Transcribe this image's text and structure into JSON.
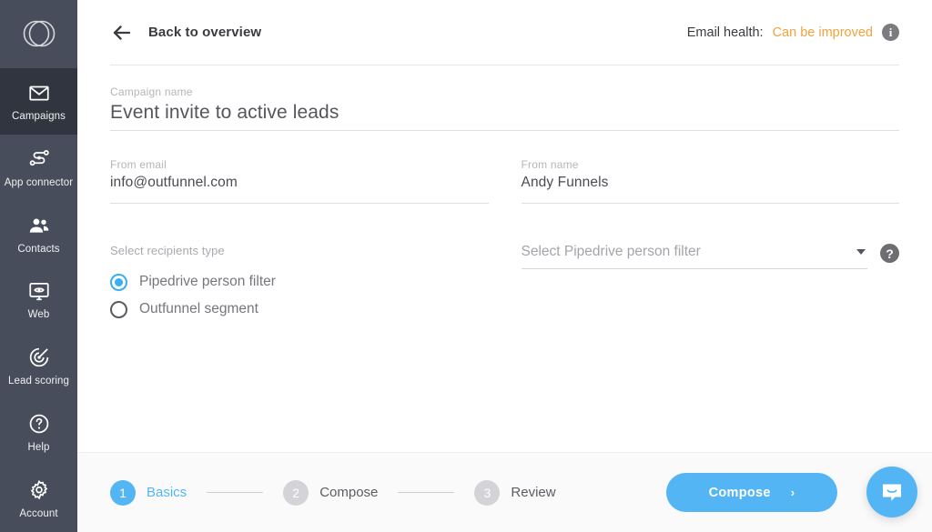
{
  "sidebar": {
    "logo_name": "outfunnel-logo",
    "items": [
      {
        "id": "campaigns",
        "label": "Campaigns",
        "icon": "envelope-icon",
        "active": true
      },
      {
        "id": "app-connector",
        "label": "App connector",
        "icon": "connector-icon",
        "active": false
      },
      {
        "id": "contacts",
        "label": "Contacts",
        "icon": "people-icon",
        "active": false
      },
      {
        "id": "web",
        "label": "Web",
        "icon": "monitor-eye-icon",
        "active": false
      },
      {
        "id": "lead-scoring",
        "label": "Lead scoring",
        "icon": "target-icon",
        "active": false
      },
      {
        "id": "help",
        "label": "Help",
        "icon": "question-circle-icon",
        "active": false
      },
      {
        "id": "account",
        "label": "Account",
        "icon": "gear-icon",
        "active": false
      }
    ]
  },
  "header": {
    "back_label": "Back to overview",
    "back_icon": "arrow-left-icon",
    "health_label": "Email health:",
    "health_value": "Can be improved",
    "health_info_icon": "i",
    "health_color": "#f3a23c"
  },
  "form": {
    "campaign_name": {
      "label": "Campaign name",
      "value": "Event invite to active leads",
      "placeholder": "Campaign name"
    },
    "from_email": {
      "label": "From email",
      "value": "info@outfunnel.com",
      "placeholder": "From email"
    },
    "from_name": {
      "label": "From name",
      "value": "Andy Funnels",
      "placeholder": "From name"
    },
    "recipients": {
      "label": "Select recipients type",
      "options": [
        {
          "label": "Pipedrive person filter",
          "selected": true
        },
        {
          "label": "Outfunnel segment",
          "selected": false
        }
      ]
    },
    "person_filter": {
      "placeholder": "Select Pipedrive person filter",
      "value": "",
      "caret_icon": "chevron-down-icon",
      "help_icon": "?"
    }
  },
  "footer": {
    "steps": [
      {
        "number": "1",
        "name": "Basics",
        "active": true
      },
      {
        "number": "2",
        "name": "Compose",
        "active": false
      },
      {
        "number": "3",
        "name": "Review",
        "active": false
      }
    ],
    "primary_button": {
      "label": "Compose",
      "chevron": "›"
    }
  },
  "chat": {
    "launcher_icon": "chat-smile-icon"
  },
  "colors": {
    "accent_blue": "#54b5f5",
    "radio_blue": "#39aef0",
    "warning_orange": "#f3a23c",
    "sidebar_bg": "#474d5b",
    "sidebar_active_bg": "#31353f",
    "footer_bg": "#fafafb"
  }
}
